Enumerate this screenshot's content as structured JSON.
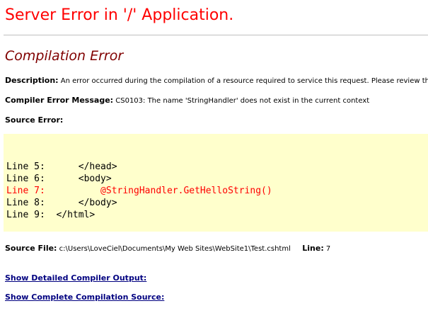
{
  "page": {
    "title": "Server Error in '/' Application.",
    "heading": "Compilation Error"
  },
  "description": {
    "label": "Description:",
    "text": "An error occurred during the compilation of a resource required to service this request. Please review the f"
  },
  "compiler_message": {
    "label": "Compiler Error Message:",
    "text": "CS0103: The name 'StringHandler' does not exist in the current context"
  },
  "source_error": {
    "label": "Source Error:",
    "lines": [
      {
        "text": "Line 5:      </head>",
        "highlight": false
      },
      {
        "text": "Line 6:      <body>",
        "highlight": false
      },
      {
        "text": "Line 7:          @StringHandler.GetHelloString()",
        "highlight": true
      },
      {
        "text": "Line 8:      </body>",
        "highlight": false
      },
      {
        "text": "Line 9:  </html>",
        "highlight": false
      }
    ]
  },
  "source_file": {
    "label": "Source File:",
    "path": "c:\\Users\\LoveCiel\\Documents\\My Web Sites\\WebSite1\\Test.cshtml",
    "line_label": "Line:",
    "line_number": "7"
  },
  "links": {
    "detailed_output": "Show Detailed Compiler Output:",
    "complete_source": "Show Complete Compilation Source:"
  },
  "colors": {
    "title": "#ff0000",
    "heading": "#800000",
    "code_background": "#ffffcc",
    "highlight_line": "#ff0000",
    "link": "#000080"
  }
}
